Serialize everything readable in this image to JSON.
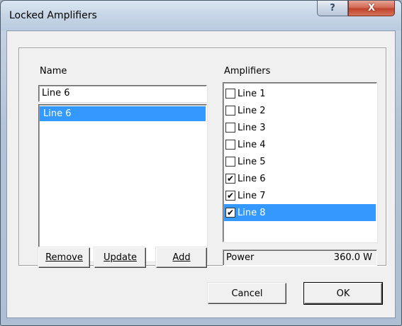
{
  "window": {
    "title": "Locked Amplifiers",
    "help_glyph": "?",
    "close_glyph": "X"
  },
  "name_panel": {
    "label": "Name",
    "input_value": "Line 6",
    "items": [
      {
        "label": "Line 6",
        "selected": true
      }
    ]
  },
  "amplifiers_panel": {
    "label": "Amplifiers",
    "items": [
      {
        "label": "Line 1",
        "checked": false,
        "selected": false
      },
      {
        "label": "Line 2",
        "checked": false,
        "selected": false
      },
      {
        "label": "Line 3",
        "checked": false,
        "selected": false
      },
      {
        "label": "Line 4",
        "checked": false,
        "selected": false
      },
      {
        "label": "Line 5",
        "checked": false,
        "selected": false
      },
      {
        "label": "Line 6",
        "checked": true,
        "selected": false
      },
      {
        "label": "Line 7",
        "checked": true,
        "selected": false
      },
      {
        "label": "Line 8",
        "checked": true,
        "selected": true
      }
    ]
  },
  "buttons": {
    "remove": "Remove",
    "update": "Update",
    "add": "Add",
    "cancel": "Cancel",
    "ok": "OK"
  },
  "power": {
    "label": "Power",
    "value": "360.0 W"
  },
  "colors": {
    "selection": "#3399ff",
    "close_button": "#c0432b"
  }
}
